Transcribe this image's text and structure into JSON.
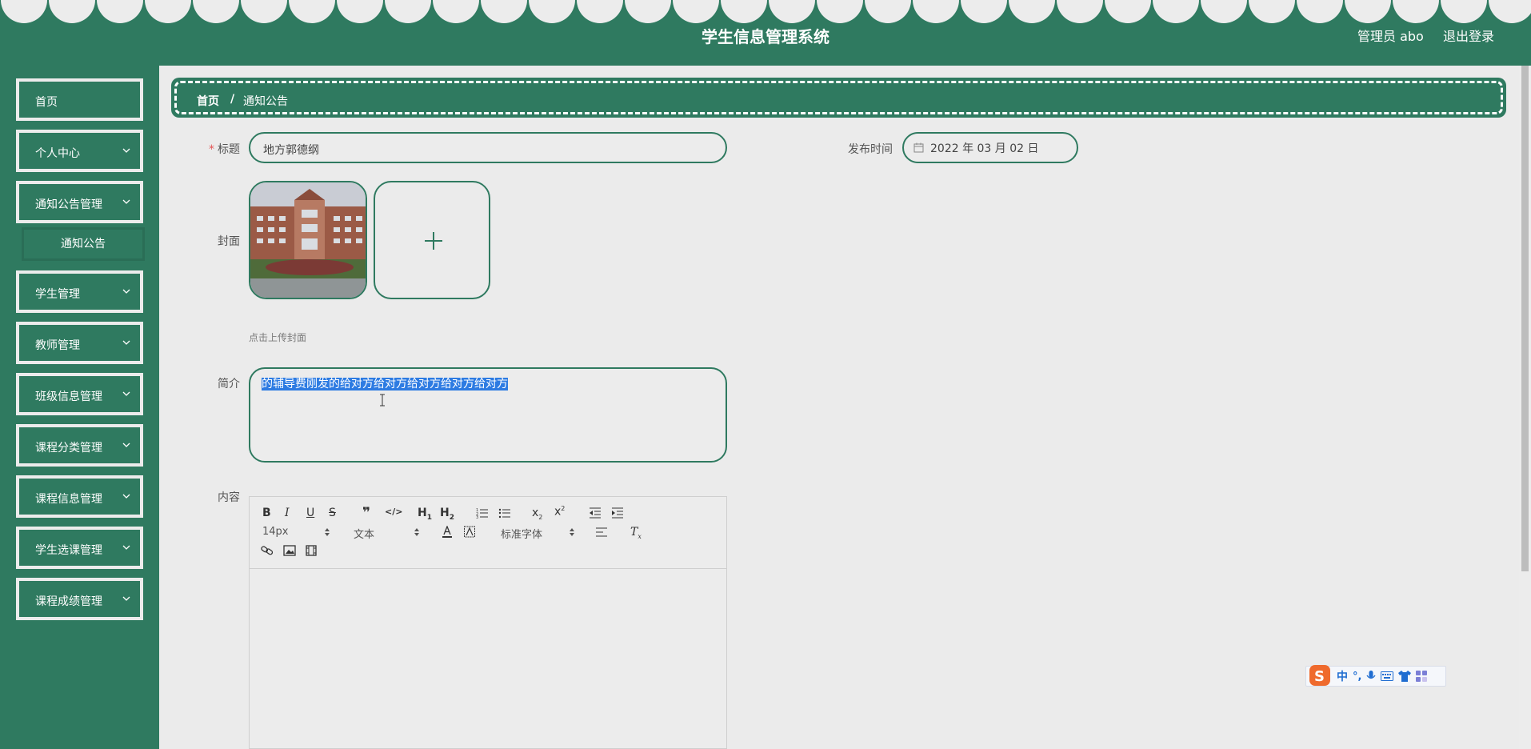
{
  "header": {
    "title": "学生信息管理系统",
    "user_label": "管理员 abo",
    "logout_label": "退出登录"
  },
  "sidebar": {
    "items": [
      {
        "label": "首页"
      },
      {
        "label": "个人中心"
      },
      {
        "label": "通知公告管理"
      },
      {
        "label": "学生管理"
      },
      {
        "label": "教师管理"
      },
      {
        "label": "班级信息管理"
      },
      {
        "label": "课程分类管理"
      },
      {
        "label": "课程信息管理"
      },
      {
        "label": "学生选课管理"
      },
      {
        "label": "课程成绩管理"
      }
    ],
    "sub_item": "通知公告"
  },
  "breadcrumb": {
    "home": "首页",
    "separator": "/",
    "current": "通知公告"
  },
  "form": {
    "title_label": "标题",
    "title_value": "地方郭德纲",
    "publish_label": "发布时间",
    "publish_value": "2022 年 03 月 02 日",
    "cover_label": "封面",
    "upload_tip": "点击上传封面",
    "intro_label": "简介",
    "intro_value": "的辅导费刚发的给对方给对方给对方给对方给对方",
    "content_label": "内容"
  },
  "editor": {
    "font_size": "14px",
    "paragraph": "文本",
    "font_family": "标准字体"
  },
  "colors": {
    "primary": "#2f7a60",
    "background": "#ebebeb",
    "selection": "#2d7be2"
  }
}
